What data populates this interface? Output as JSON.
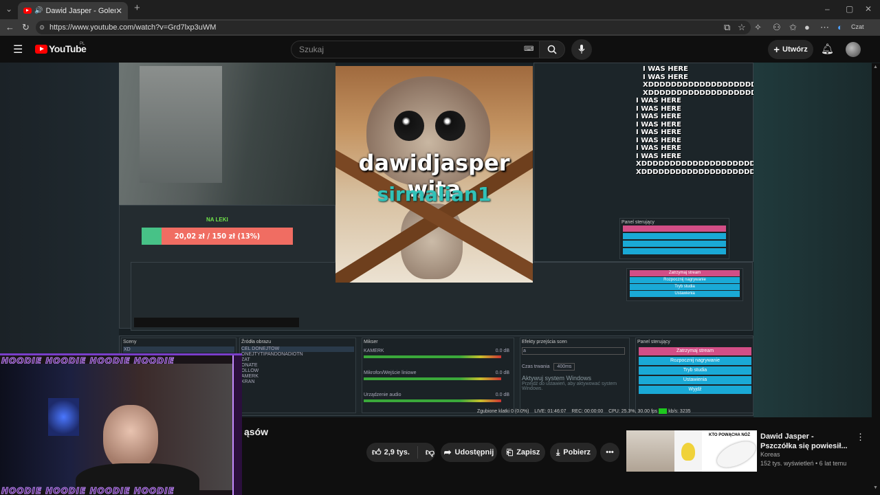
{
  "browser": {
    "tab_title": "Dawid Jasper - Golenie brwi, ",
    "url": "https://www.youtube.com/watch?v=Grd7lxp3uWM",
    "chat_label": "Czat"
  },
  "youtube": {
    "logo_text": "YouTube",
    "logo_country": "PL",
    "search_placeholder": "Szukaj",
    "create_label": "Utwórz"
  },
  "video": {
    "overlay_title": "dawidjasper wita",
    "overlay_subtitle": "sirmalian1",
    "goal_label": "NA LEKI",
    "goal_text": "20,02 zł / 150 zł (13%)",
    "goal_fraction": 0.13,
    "spam_lines": [
      "I WAS HERE",
      "I WAS HERE",
      "XDDDDDDDDDDDDDDDDDDDD",
      "XDDDDDDDDDDDDDDDDDDDD",
      "I WAS HERE",
      "I WAS HERE",
      "I WAS HERE",
      "I WAS HERE",
      "I WAS HERE",
      "I WAS HERE",
      "I WAS HERE",
      "I WAS HERE",
      "XDDDDDDDDDDDDDDDDDDDD",
      "XDDDDDDDDDDDDDDDDDDDD"
    ],
    "obs": {
      "scenes": "Sceny",
      "sources": "Źródła obrazu",
      "mixer": "Mikser",
      "transitions": "Efekty przejścia scen",
      "controls": "Panel sterujący",
      "scene_item": "XD",
      "source_items": [
        "CEL DONEJTOW",
        "ONEJTYTIPANDONADIOTN",
        "ZAT",
        "ONATE",
        "OLLOW",
        "AMERK",
        "KRAN"
      ],
      "mixer_items": [
        "KAMERK",
        "Mikrofon/Wejście liniowe",
        "Urządzenie audio"
      ],
      "db_value": "0.0 dB",
      "transition_value": "a",
      "duration_label": "Czas trwania",
      "duration_value": "400ms",
      "control_buttons": [
        "Zatrzymaj stream",
        "Rozpocznij nagrywanie",
        "Tryb studia",
        "Ustawienia",
        "Wyjdź"
      ],
      "status": {
        "dropped": "Zgubione klatki 0 (0.0%)",
        "live": "LIVE: 01:46:07",
        "rec": "REC: 00:00:00",
        "cpu": "CPU: 25.3%, 30.00 fps",
        "kbps": "kb/s: 3235"
      },
      "activate_windows": "Aktywuj system Windows",
      "activate_windows_sub": "Przejdź do ustawień, aby aktywować system Windows."
    },
    "webcam_banner": "HOODIE HOODIE HOODIE HOODIE"
  },
  "below": {
    "title_fragment": "ąsów",
    "like_count": "2,9 tys.",
    "share_label": "Udostępnij",
    "save_label": "Zapisz",
    "download_label": "Pobierz"
  },
  "suggestion": {
    "title": "Dawid Jasper - Pszczółka się powiesił...",
    "channel": "Koreas",
    "meta": "152 tys. wyświetleń • 6 lat temu",
    "thumb_label": "KTO POWĄCHA NÓŻ"
  },
  "colors": {
    "youtube_red": "#ff0000",
    "obs_blue": "#1aa9d6",
    "obs_pink": "#d24e86",
    "goal_green": "#47c287",
    "goal_red": "#f06d62"
  }
}
